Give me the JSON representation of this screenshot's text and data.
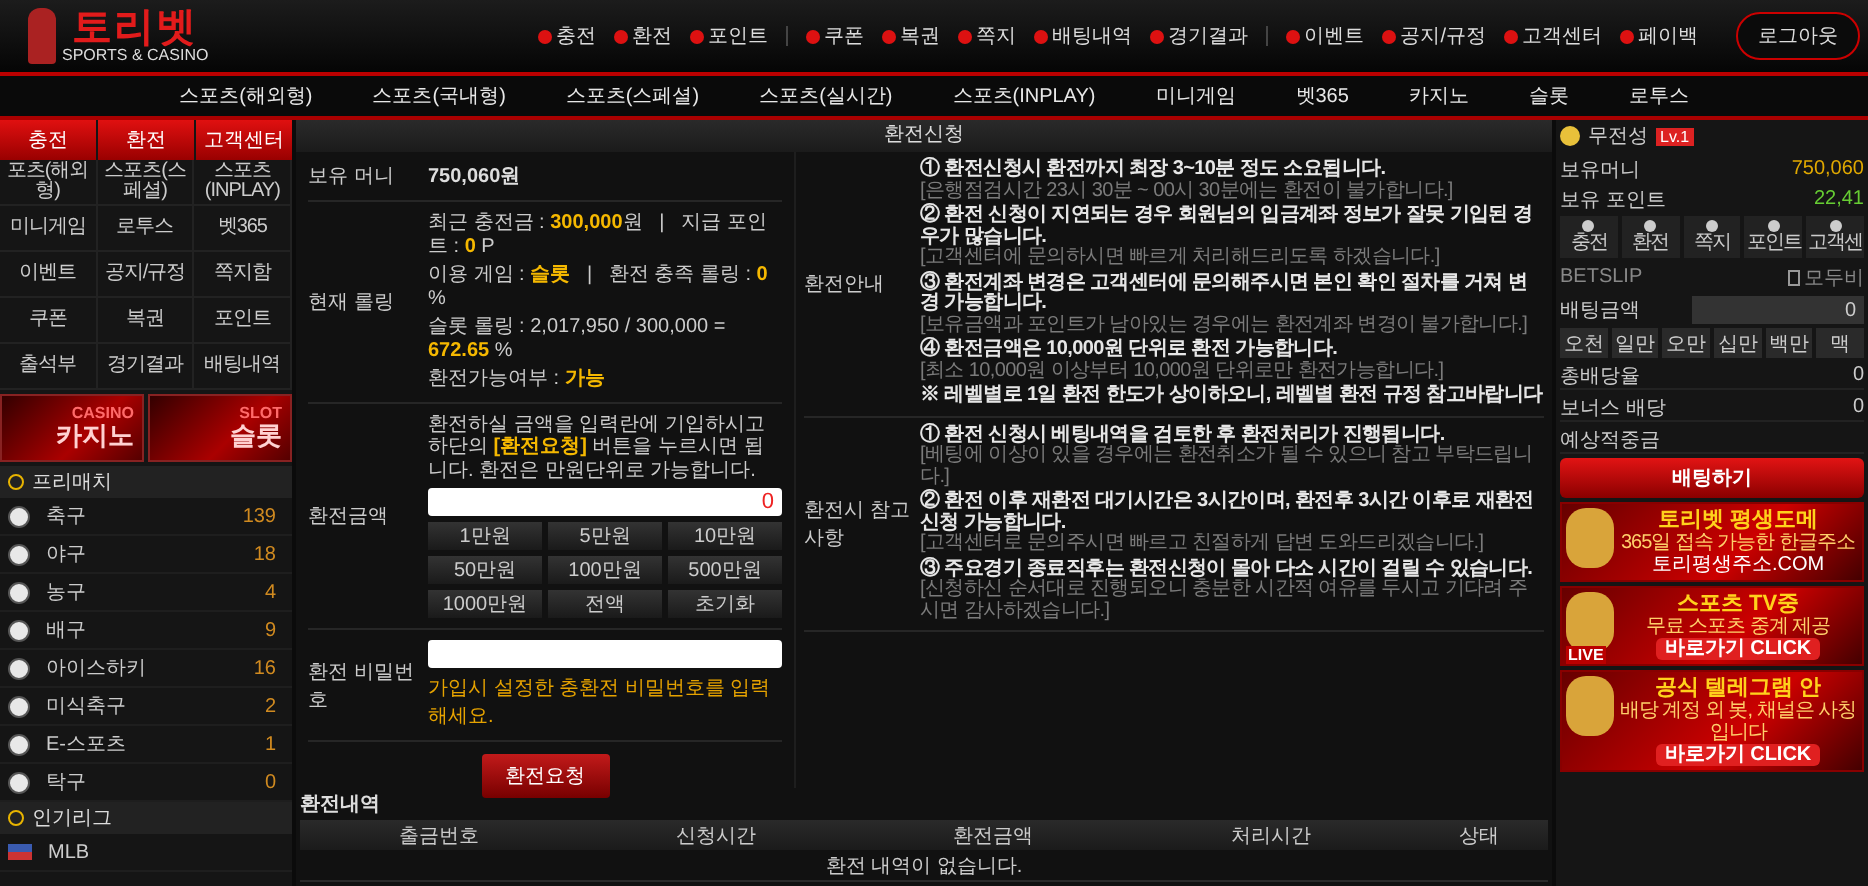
{
  "header": {
    "logo": {
      "title": "토리벳",
      "subtitle": "SPORTS & CASINO"
    },
    "link_groups": [
      [
        "충전",
        "환전",
        "포인트"
      ],
      [
        "쿠폰",
        "복권",
        "쪽지",
        "배팅내역",
        "경기결과"
      ],
      [
        "이벤트",
        "공지/규정",
        "고객센터",
        "페이백"
      ]
    ],
    "logout_button": "로그아웃"
  },
  "main_nav": [
    "스포츠(해외형)",
    "스포츠(국내형)",
    "스포츠(스페셜)",
    "스포츠(실시간)",
    "스포츠(INPLAY)",
    "미니게임",
    "벳365",
    "카지노",
    "슬롯",
    "로투스"
  ],
  "left_sidebar": {
    "quick_buttons": [
      "충전",
      "환전",
      "고객센터"
    ],
    "menu": [
      "포츠(해외형)",
      "스포츠(스페셜)",
      "스포츠(INPLAY)",
      "미니게임",
      "로투스",
      "벳365",
      "이벤트",
      "공지/규정",
      "쪽지함",
      "쿠폰",
      "복권",
      "포인트",
      "출석부",
      "경기결과",
      "배팅내역"
    ],
    "banners": [
      {
        "tag": "CASINO",
        "title": "카지노"
      },
      {
        "tag": "SLOT",
        "title": "슬롯"
      }
    ],
    "prematch": {
      "title": "프리매치",
      "sports": [
        {
          "name": "축구",
          "count": "139"
        },
        {
          "name": "야구",
          "count": "18"
        },
        {
          "name": "농구",
          "count": "4"
        },
        {
          "name": "배구",
          "count": "9"
        },
        {
          "name": "아이스하키",
          "count": "16"
        },
        {
          "name": "미식축구",
          "count": "2"
        },
        {
          "name": "E-스포츠",
          "count": "1"
        },
        {
          "name": "탁구",
          "count": "0"
        }
      ]
    },
    "popular": {
      "title": "인기리그",
      "leagues": [
        "MLB"
      ]
    }
  },
  "exchange": {
    "title": "환전신청",
    "balance": {
      "label": "보유 머니",
      "value": "750,060원"
    },
    "rolling": {
      "label": "현재 롤링",
      "lines": [
        "최근 충전금 : **300,000**원   |   지급 포인트 : **0** P",
        "이용 게임 : **슬롯**   |   환전 충족 롤링 : **0** %",
        "슬롯 롤링 : 2,017,950 / 300,000 = **672.65** %",
        "환전가능여부 : **가능**"
      ]
    },
    "amount": {
      "label": "환전금액",
      "description": "환전하실 금액을 입력란에 기입하시고 하단의 **[환전요청]** 버튼을 누르시면 됩니다. 환전은 만원단위로 가능합니다.",
      "value": "0",
      "buttons": [
        "1만원",
        "5만원",
        "10만원",
        "50만원",
        "100만원",
        "500만원",
        "1000만원",
        "전액",
        "초기화"
      ]
    },
    "password": {
      "label": "환전 비밀번호",
      "hint": "가입시 설정한 충환전 비밀번호를 입력해세요."
    },
    "submit_button": "환전요청",
    "guide": {
      "label": "환전안내",
      "items": [
        {
          "title": "① 환전신청시 환전까지 최장 3~10분 정도 소요됩니다.",
          "note": "[은행점검시간 23시 30분 ~ 00시 30분에는 환전이 불가합니다.]"
        },
        {
          "title": "② 환전 신청이 지연되는 경우 회원님의 입금계좌 정보가 잘못 기입된 경우가 많습니다.",
          "note": "[고객센터에 문의하시면 빠르게 처리해드리도록 하겠습니다.]"
        },
        {
          "title": "③ 환전계좌 변경은 고객센터에 문의해주시면 본인 확인 절차를 거쳐 변경 가능합니다.",
          "note": "[보유금액과 포인트가 남아있는 경우에는 환전계좌 변경이 불가합니다.]"
        },
        {
          "title": "④ 환전금액은 10,000원 단위로 환전 가능합니다.",
          "note": "[최소 10,000원 이상부터 10,000원 단위로만 환전가능합니다.]"
        }
      ],
      "footer": "※ 레벨별로 1일 환전 한도가 상이하오니, 레벨별 환전 규정 참고바랍니다"
    },
    "notes": {
      "label": "환전시 참고사항",
      "items": [
        {
          "title": "① 환전 신청시 베팅내역을 검토한 후 환전처리가 진행됩니다.",
          "note": "[베팅에 이상이 있을 경우에는 환전취소가 될 수 있으니 참고 부탁드립니다.]"
        },
        {
          "title": "② 환전 이후 재환전 대기시간은 3시간이며, 환전후 3시간 이후로 재환전 신청 가능합니다.",
          "note": "[고객센터로 문의주시면 빠르고 친절하게 답변 도와드리겠습니다.]"
        },
        {
          "title": "③ 주요경기 종료직후는 환전신청이 몰아 다소 시간이 걸릴 수 있습니다.",
          "note": "[신청하신 순서대로 진행되오니 충분한 시간적 여유를 두시고 기다려 주시면 감사하겠습니다.]"
        }
      ]
    }
  },
  "history": {
    "title": "환전내역",
    "columns": [
      "출금번호",
      "신청시간",
      "환전금액",
      "처리시간",
      "상태"
    ],
    "empty": "환전 내역이 없습니다."
  },
  "right_sidebar": {
    "user": {
      "name": "무전성",
      "level": "Lv.1"
    },
    "balances": [
      {
        "label": "보유머니",
        "value": "750,060"
      },
      {
        "label": "보유 포인트",
        "value": "22,41"
      }
    ],
    "quick_buttons": [
      "충전",
      "환전",
      "쪽지",
      "포인트",
      "고객센"
    ],
    "betslip": {
      "title": "BETSLIP",
      "clear": "모두비",
      "amount_label": "배팅금액",
      "amount_value": "0",
      "chips": [
        "오천",
        "일만",
        "오만",
        "십만",
        "백만",
        "맥"
      ],
      "rows": [
        {
          "label": "총배당율",
          "value": "0"
        },
        {
          "label": "보너스 배당",
          "value": "0"
        },
        {
          "label": "예상적중금"
        }
      ],
      "bet_button": "배팅하기"
    },
    "banners": [
      {
        "title": "토리벳 평생도메",
        "subtitle": "365일 접속 가능한 한글주소",
        "link": "토리평생주소.COM"
      },
      {
        "title": "스포츠 TV중",
        "subtitle": "무료 스포츠 중계 제공",
        "button": "바로가기 CLICK",
        "badge": "LIVE"
      },
      {
        "title": "공식 텔레그램 안",
        "subtitle": "배당 계정 외 봇, 채널은 사칭입니다",
        "button": "바로가기 CLICK"
      }
    ]
  }
}
